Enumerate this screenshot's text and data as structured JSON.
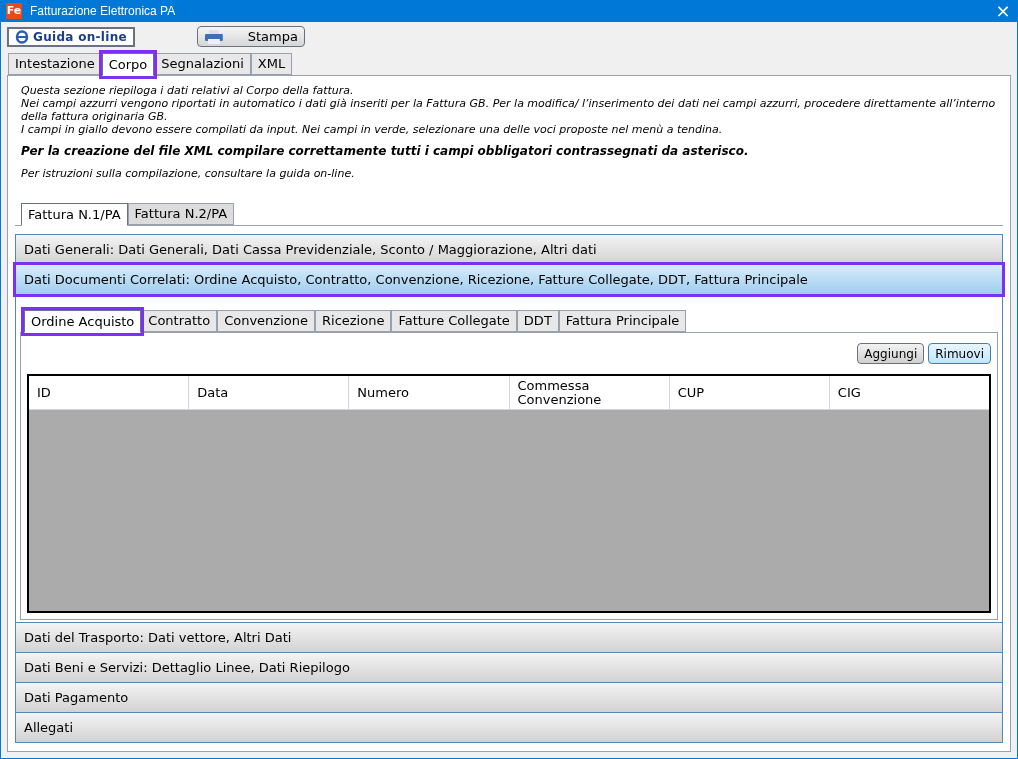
{
  "window": {
    "title": "Fatturazione Elettronica PA",
    "logo": "Fe",
    "close": "×"
  },
  "toolbar": [
    {
      "kind": "help",
      "label": "Guida on-line"
    },
    {
      "kind": "print",
      "label": "Stampa"
    }
  ],
  "tabs": [
    {
      "label": "Intestazione",
      "selected": false,
      "highlighted": false
    },
    {
      "label": "Corpo",
      "selected": true,
      "highlighted": true
    },
    {
      "label": "Segnalazioni",
      "selected": false,
      "highlighted": false
    },
    {
      "label": "XML",
      "selected": false,
      "highlighted": false
    }
  ],
  "intro": [
    {
      "kind": "plain",
      "text": "Questa sezione riepiloga i dati relativi al Corpo della fattura.\nNei campi azzurri vengono riportati in automatico i dati già inseriti per la Fattura GB. Per la modifica/ l’inserimento dei dati nei campi azzurri, procedere direttamente all’interno della fattura originaria GB.\nI campi in giallo devono essere compilati da input. Nei campi in verde, selezionare una delle voci proposte nel menù a tendina."
    },
    {
      "kind": "bold",
      "text": "Per la creazione del file XML compilare correttamente tutti i campi obbligatori contrassegnati da asterisco."
    },
    {
      "kind": "plain",
      "text": "Per istruzioni sulla compilazione, consultare la guida on-line."
    }
  ],
  "invoice_tabs": [
    {
      "label": "Fattura N.1/PA",
      "selected": true
    },
    {
      "label": "Fattura N.2/PA",
      "selected": false
    }
  ],
  "sections": [
    {
      "title": "Dati Generali: Dati Generali, Dati Cassa Previdenziale, Sconto / Maggiorazione, Altri dati",
      "expanded": false,
      "highlighted": false
    },
    {
      "title": "Dati Documenti Correlati: Ordine Acquisto, Contratto, Convenzione, Ricezione, Fatture Collegate, DDT, Fattura Principale",
      "expanded": true,
      "highlighted": true,
      "tabs": [
        {
          "label": "Ordine Acquisto",
          "selected": true,
          "highlighted": true
        },
        {
          "label": "Contratto",
          "selected": false,
          "highlighted": false
        },
        {
          "label": "Convenzione",
          "selected": false,
          "highlighted": false
        },
        {
          "label": "Ricezione",
          "selected": false,
          "highlighted": false
        },
        {
          "label": "Fatture Collegate",
          "selected": false,
          "highlighted": false
        },
        {
          "label": "DDT",
          "selected": false,
          "highlighted": false
        },
        {
          "label": "Fattura Principale",
          "selected": false,
          "highlighted": false
        }
      ],
      "buttons": [
        {
          "label": "Aggiungi",
          "selected": false
        },
        {
          "label": "Rimuovi",
          "selected": true
        }
      ],
      "table": {
        "columns": [
          "ID",
          "Data",
          "Numero",
          "Commessa\nConvenzione",
          "CUP",
          "CIG"
        ]
      }
    },
    {
      "title": "Dati del Trasporto: Dati vettore, Altri Dati",
      "expanded": false,
      "highlighted": false
    },
    {
      "title": "Dati Beni e Servizi: Dettaglio Linee, Dati Riepilogo",
      "expanded": false,
      "highlighted": false
    },
    {
      "title": "Dati Pagamento",
      "expanded": false,
      "highlighted": false
    },
    {
      "title": "Allegati",
      "expanded": false,
      "highlighted": false
    }
  ]
}
